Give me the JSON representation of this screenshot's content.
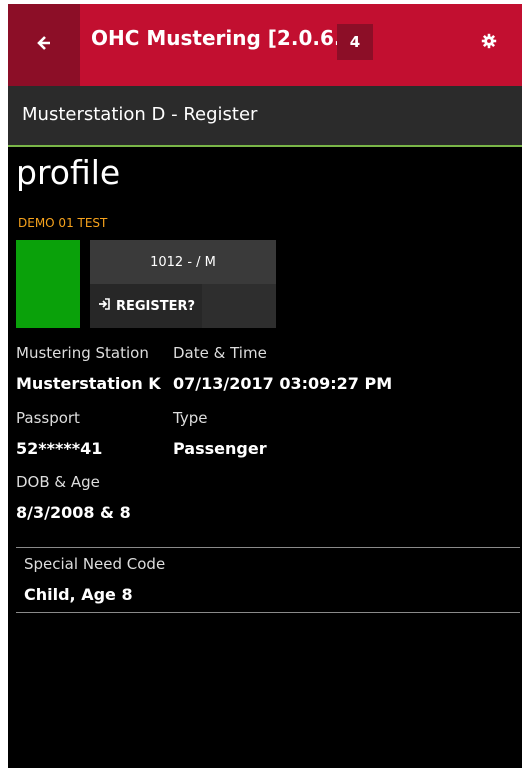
{
  "app": {
    "title": "OHC Mustering [2.0.6.0]",
    "badge_count": "4"
  },
  "subheader": {
    "title": "Musterstation D - Register"
  },
  "profile": {
    "section_title": "profile",
    "name": "DEMO 01 TEST",
    "id_line": "1012 -  / M",
    "register_label": "REGISTER?",
    "avatar_color": "#0aa10a"
  },
  "fields": {
    "mustering_station": {
      "label": "Mustering Station",
      "value": "Musterstation K"
    },
    "date_time": {
      "label": "Date & Time",
      "value": "07/13/2017 03:09:27 PM"
    },
    "passport": {
      "label": "Passport",
      "value": "52*****41"
    },
    "type": {
      "label": "Type",
      "value": "Passenger"
    },
    "dob_age": {
      "label": "DOB & Age",
      "value": "8/3/2008 & 8"
    },
    "special_need": {
      "label": "Special Need Code",
      "value": "Child, Age 8"
    }
  },
  "colors": {
    "accent": "#c20f30",
    "accent_dark": "#8c0e27",
    "name_highlight": "#f6a21c",
    "separator": "#7ab648"
  },
  "icons": {
    "back": "arrow-left-icon",
    "settings": "gear-icon",
    "register": "sign-in-icon"
  }
}
